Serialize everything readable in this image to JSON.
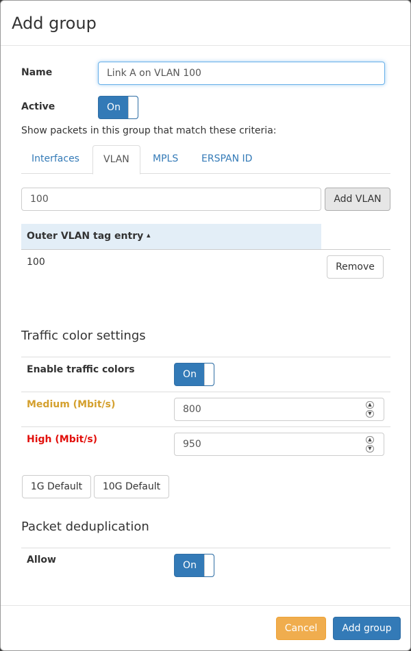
{
  "dialog": {
    "title": "Add group"
  },
  "form": {
    "name_label": "Name",
    "name_value": "Link A on VLAN 100",
    "active_label": "Active",
    "active_toggle": "On",
    "criteria_text": "Show packets in this group that match these criteria:"
  },
  "tabs": [
    {
      "label": "Interfaces",
      "active": false
    },
    {
      "label": "VLAN",
      "active": true
    },
    {
      "label": "MPLS",
      "active": false
    },
    {
      "label": "ERSPAN ID",
      "active": false
    }
  ],
  "vlan": {
    "input_value": "100",
    "add_button": "Add VLAN",
    "table_header": "Outer VLAN tag entry",
    "sort_indicator": "▴",
    "rows": [
      {
        "value": "100",
        "remove_label": "Remove"
      }
    ]
  },
  "traffic": {
    "title": "Traffic color settings",
    "enable_label": "Enable traffic colors",
    "enable_toggle": "On",
    "medium_label": "Medium (Mbit/s)",
    "medium_value": "800",
    "medium_color": "#d4a02e",
    "high_label": "High (Mbit/s)",
    "high_value": "950",
    "high_color": "#e2100c",
    "default_1g": "1G Default",
    "default_10g": "10G Default"
  },
  "dedup": {
    "title": "Packet deduplication",
    "allow_label": "Allow",
    "allow_toggle": "On"
  },
  "footer": {
    "cancel_label": "Cancel",
    "submit_label": "Add group"
  },
  "colors": {
    "primary": "#337ab7",
    "warning": "#f0ad4e",
    "table_header_bg": "#e3eef7"
  }
}
